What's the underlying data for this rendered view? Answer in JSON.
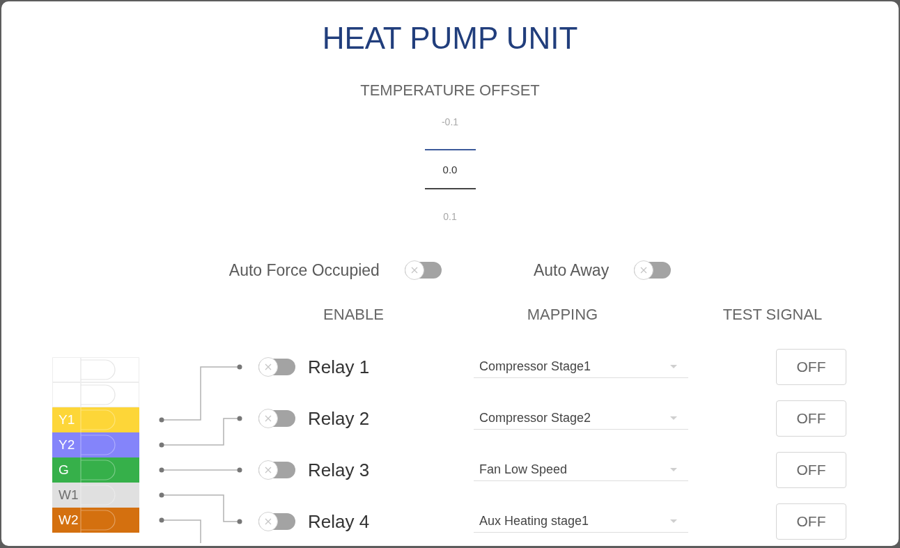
{
  "title": "HEAT PUMP UNIT",
  "temperature_offset": {
    "label": "TEMPERATURE OFFSET",
    "options": [
      {
        "value": "-0.1",
        "selected": false
      },
      {
        "value": "0.0",
        "selected": true
      },
      {
        "value": "0.1",
        "selected": false
      }
    ]
  },
  "switches": [
    {
      "label": "Auto Force Occupied",
      "on": false
    },
    {
      "label": "Auto Away",
      "on": false
    }
  ],
  "wire_terminals": [
    {
      "kind": "empty"
    },
    {
      "kind": "empty"
    },
    {
      "kind": "wire",
      "label": "Y1",
      "color": "#fdd638"
    },
    {
      "kind": "wire",
      "label": "Y2",
      "color": "#8484fa"
    },
    {
      "kind": "wire",
      "label": "G",
      "color": "#36b04a"
    },
    {
      "kind": "wire",
      "label": "W1",
      "color": "#e0e0e0"
    },
    {
      "kind": "wire",
      "label": "W2",
      "color": "#d4700f"
    }
  ],
  "relays": {
    "columns": [
      "ENABLE",
      "MAPPING",
      "TEST SIGNAL"
    ],
    "rows": [
      {
        "name": "Relay 1",
        "enabled": false,
        "mapping": "Compressor Stage1",
        "test_signal": "OFF"
      },
      {
        "name": "Relay 2",
        "enabled": false,
        "mapping": "Compressor Stage2",
        "test_signal": "OFF"
      },
      {
        "name": "Relay 3",
        "enabled": false,
        "mapping": "Fan Low Speed",
        "test_signal": "OFF"
      },
      {
        "name": "Relay 4",
        "enabled": false,
        "mapping": "Aux Heating stage1",
        "test_signal": "OFF"
      }
    ]
  }
}
